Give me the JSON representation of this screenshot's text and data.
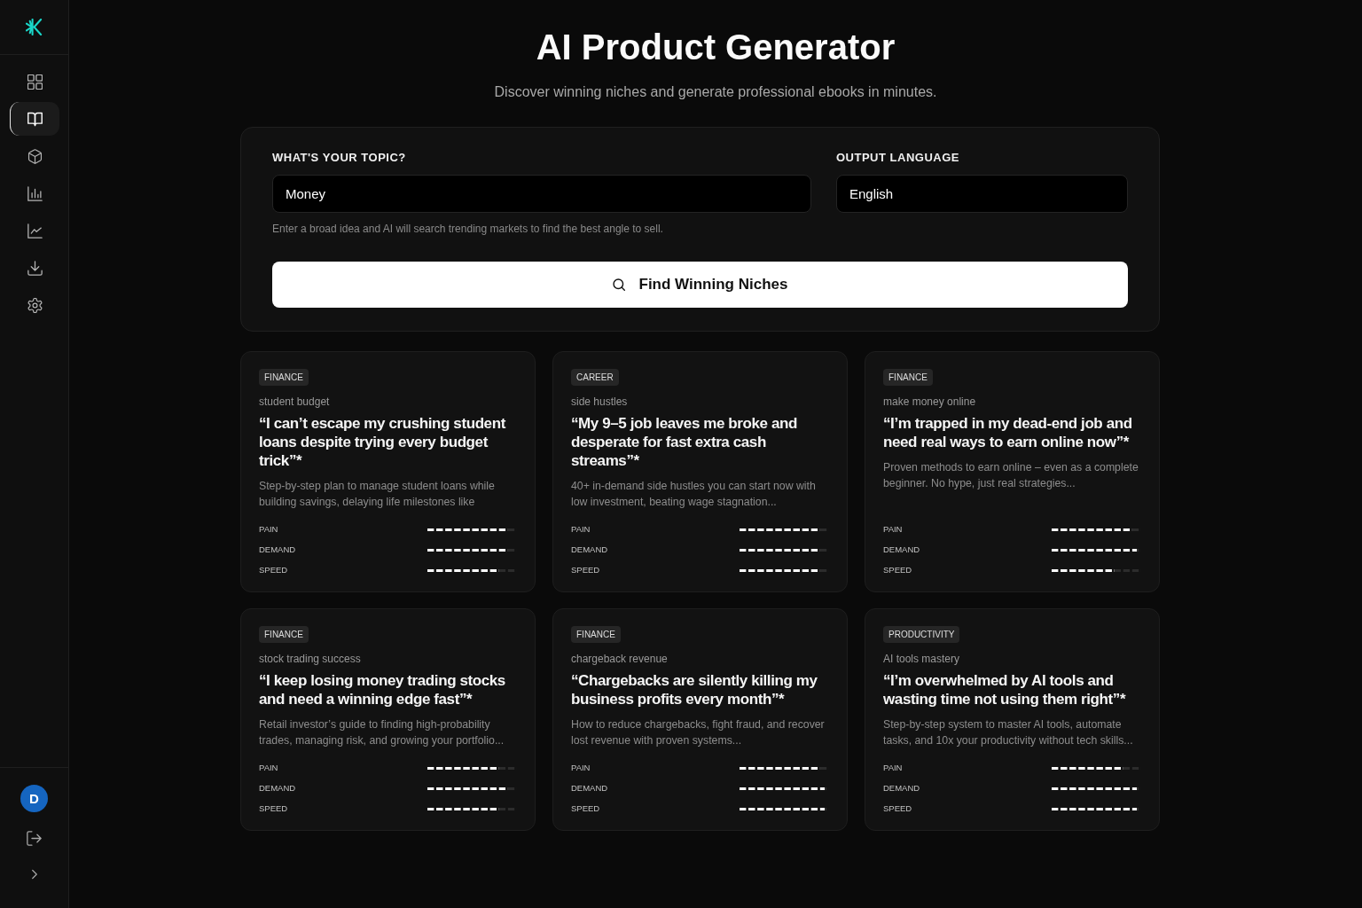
{
  "sidebar": {
    "nav": [
      {
        "kind": "grid",
        "selected": false
      },
      {
        "kind": "book",
        "selected": true
      },
      {
        "kind": "cube",
        "selected": false
      },
      {
        "kind": "bar-chart",
        "selected": false
      },
      {
        "kind": "line-chart",
        "selected": false
      },
      {
        "kind": "download",
        "selected": false
      },
      {
        "kind": "settings",
        "selected": false
      }
    ],
    "user": {
      "initial": "D"
    }
  },
  "header": {
    "title": "AI Product Generator",
    "subtitle": "Discover winning niches and generate professional ebooks in minutes."
  },
  "form": {
    "fields": [
      {
        "label": "WHAT'S YOUR TOPIC?",
        "value": "Money"
      },
      {
        "label": "OUTPUT LANGUAGE",
        "value": "English"
      }
    ],
    "hint": "Enter a broad idea and AI will search trending markets to find the best angle to sell.",
    "button": "Find Winning Niches"
  },
  "niches": [
    {
      "tag": "FINANCE",
      "keyword": "student budget",
      "headline": "“I can’t escape my crushing student loans despite trying every budget trick”*",
      "description": "Step-by-step plan to manage student loans while building savings, delaying life milestones like",
      "metrics": [
        {
          "label": "PAIN",
          "level": 0.9
        },
        {
          "label": "DEMAND",
          "level": 0.9
        },
        {
          "label": "SPEED",
          "level": 0.8
        }
      ]
    },
    {
      "tag": "CAREER",
      "keyword": "side hustles",
      "headline": "“My 9–5 job leaves me broke and desperate for fast extra cash streams”*",
      "description": "40+ in-demand side hustles you can start now with low investment, beating wage stagnation...",
      "metrics": [
        {
          "label": "PAIN",
          "level": 0.9
        },
        {
          "label": "DEMAND",
          "level": 0.9
        },
        {
          "label": "SPEED",
          "level": 0.9
        }
      ]
    },
    {
      "tag": "FINANCE",
      "keyword": "make money online",
      "headline": "“I’m trapped in my dead-end job and need real ways to earn online now”*",
      "description": "Proven methods to earn online – even as a complete beginner. No hype, just real strategies...",
      "metrics": [
        {
          "label": "PAIN",
          "level": 0.9
        },
        {
          "label": "DEMAND",
          "level": 0.95
        },
        {
          "label": "SPEED",
          "level": 0.7
        }
      ]
    },
    {
      "tag": "FINANCE",
      "keyword": "stock trading success",
      "headline": "“I keep losing money trading stocks and need a winning edge fast”*",
      "description": "Retail investor’s guide to finding high-probability trades, managing risk, and growing your portfolio...",
      "metrics": [
        {
          "label": "PAIN",
          "level": 0.8
        },
        {
          "label": "DEMAND",
          "level": 0.9
        },
        {
          "label": "SPEED",
          "level": 0.8
        }
      ]
    },
    {
      "tag": "FINANCE",
      "keyword": "chargeback revenue",
      "headline": "“Chargebacks are silently killing my business profits every month”*",
      "description": "How to reduce chargebacks, fight fraud, and recover lost revenue with proven systems...",
      "metrics": [
        {
          "label": "PAIN",
          "level": 0.9
        },
        {
          "label": "DEMAND",
          "level": 0.95
        },
        {
          "label": "SPEED",
          "level": 0.95
        }
      ]
    },
    {
      "tag": "PRODUCTIVITY",
      "keyword": "AI tools mastery",
      "headline": "“I’m overwhelmed by AI tools and wasting time not using them right”*",
      "description": "Step-by-step system to master AI tools, automate tasks, and 10x your productivity without tech skills...",
      "metrics": [
        {
          "label": "PAIN",
          "level": 0.8
        },
        {
          "label": "DEMAND",
          "level": 0.95
        },
        {
          "label": "SPEED",
          "level": 0.95
        }
      ]
    }
  ]
}
